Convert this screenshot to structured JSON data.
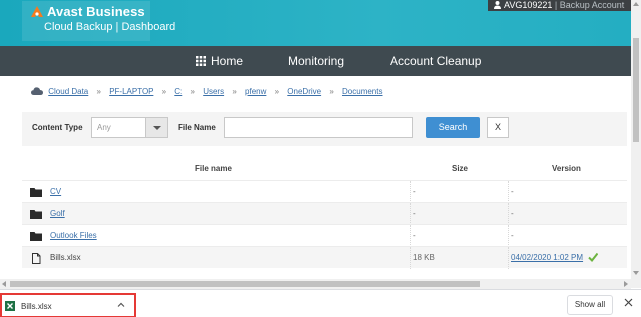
{
  "header": {
    "brand_name": "Avast Business",
    "brand_subtitle": "Cloud Backup | Dashboard",
    "account_id": "AVG109221",
    "account_label": "Backup Account"
  },
  "nav": {
    "home": "Home",
    "monitoring": "Monitoring",
    "cleanup": "Account Cleanup"
  },
  "breadcrumb": [
    "Cloud Data",
    "PF-LAPTOP",
    "C:",
    "Users",
    "pfenw",
    "OneDrive",
    "Documents"
  ],
  "filter": {
    "content_type_label": "Content Type",
    "content_type_value": "Any",
    "file_name_label": "File Name",
    "file_name_value": "",
    "search_label": "Search",
    "clear_label": "X"
  },
  "table": {
    "headers": {
      "name": "File name",
      "size": "Size",
      "version": "Version"
    },
    "rows": [
      {
        "type": "folder",
        "name": "CV",
        "size": "-",
        "version": "-"
      },
      {
        "type": "folder",
        "name": "Golf",
        "size": "-",
        "version": "-"
      },
      {
        "type": "folder",
        "name": "Outlook Files",
        "size": "-",
        "version": "-"
      },
      {
        "type": "file",
        "name": "Bills.xlsx",
        "size": "18 KB",
        "version": "04/02/2020 1:02 PM"
      }
    ]
  },
  "downloads": {
    "file_name": "Bills.xlsx",
    "show_all": "Show all"
  },
  "colors": {
    "header_teal": "#24aec2",
    "nav_dark": "#3f4a50",
    "brand_orange": "#f47b20",
    "search_blue": "#3f8fd2",
    "link_blue": "#3a6fa8",
    "check_green": "#6cb33f",
    "highlight_red": "#e53935"
  }
}
